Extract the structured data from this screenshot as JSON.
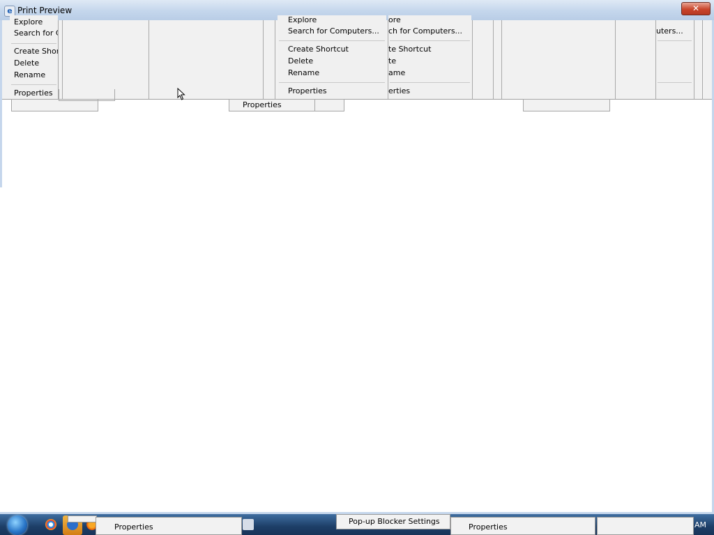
{
  "window": {
    "title": "Print Preview",
    "title_icon": "e",
    "close_glyph": "✕"
  },
  "menu_left": {
    "items": [
      "Explore",
      "Search for C",
      "Create Short",
      "Delete",
      "Rename",
      "Properties"
    ]
  },
  "menu_center": {
    "items": [
      "Explore",
      "Search for Computers...",
      "Create Shortcut",
      "Delete",
      "Rename",
      "Properties"
    ]
  },
  "menu_center_dup": {
    "items": [
      "ore",
      "ch for Computers...",
      "te Shortcut",
      "te",
      "ame",
      "erties"
    ]
  },
  "menu_right": {
    "items": [
      "uters..."
    ]
  },
  "ghost_boxes": {
    "center_label": "Properties"
  },
  "taskbar": {
    "properties_left": "Properties",
    "popup_blocker": "Pop-up Blocker Settings",
    "properties_right": "Properties",
    "clock": "AM"
  },
  "colors": {
    "titlebar": "#c4d6ec",
    "close_button": "#c9452b",
    "taskbar": "#1d3e67"
  }
}
